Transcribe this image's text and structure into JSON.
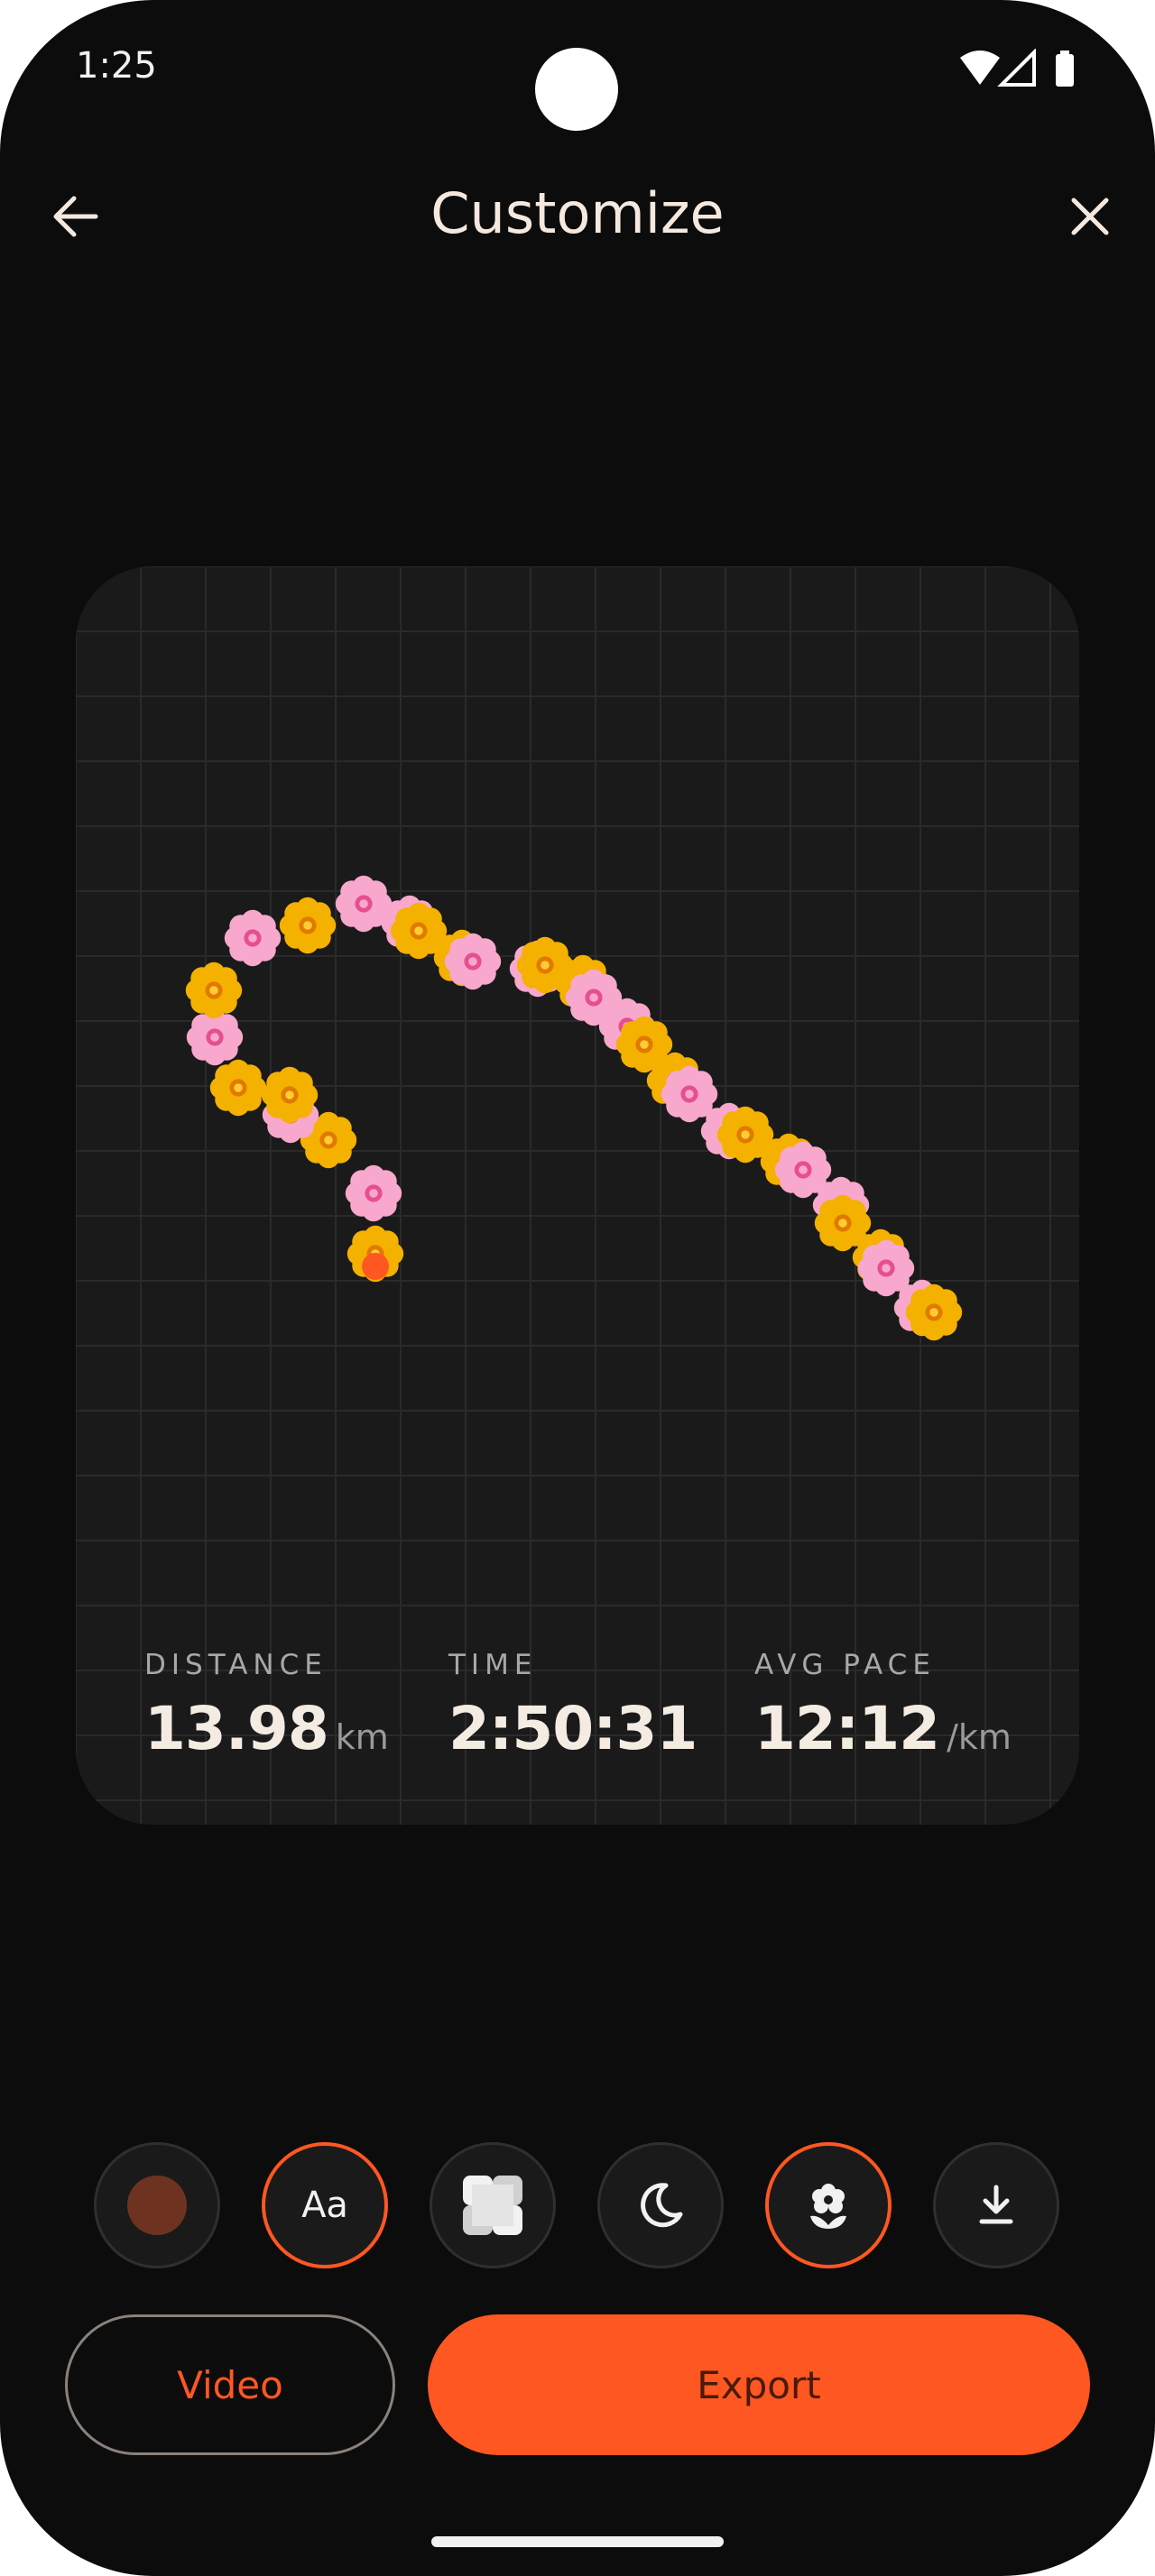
{
  "status_bar": {
    "time": "1:25",
    "icons": [
      "wifi-icon",
      "signal-icon",
      "battery-icon"
    ]
  },
  "header": {
    "title": "Customize",
    "back_icon": "back-arrow-icon",
    "close_icon": "close-icon"
  },
  "card": {
    "stats": [
      {
        "label": "DISTANCE",
        "value": "13.98",
        "unit": "km"
      },
      {
        "label": "TIME",
        "value": "2:50:31",
        "unit": ""
      },
      {
        "label": "AVG PACE",
        "value": "12:12",
        "unit": "/km"
      }
    ],
    "route_marker_color": "#ff5722",
    "flower_colors": {
      "yellow": "#f5b100",
      "pink": "#f7a8cc"
    }
  },
  "toolbar": {
    "color_swatch": "#6e3320",
    "text_button_label": "Aa",
    "icons": [
      "color-swatch",
      "text-style-icon",
      "background-pattern-icon",
      "dark-mode-icon",
      "flower-sticker-icon",
      "download-icon"
    ]
  },
  "actions": {
    "video_label": "Video",
    "export_label": "Export"
  },
  "colors": {
    "accent": "#ff5722",
    "background": "#0c0c0c",
    "card": "#1a1a1a"
  }
}
